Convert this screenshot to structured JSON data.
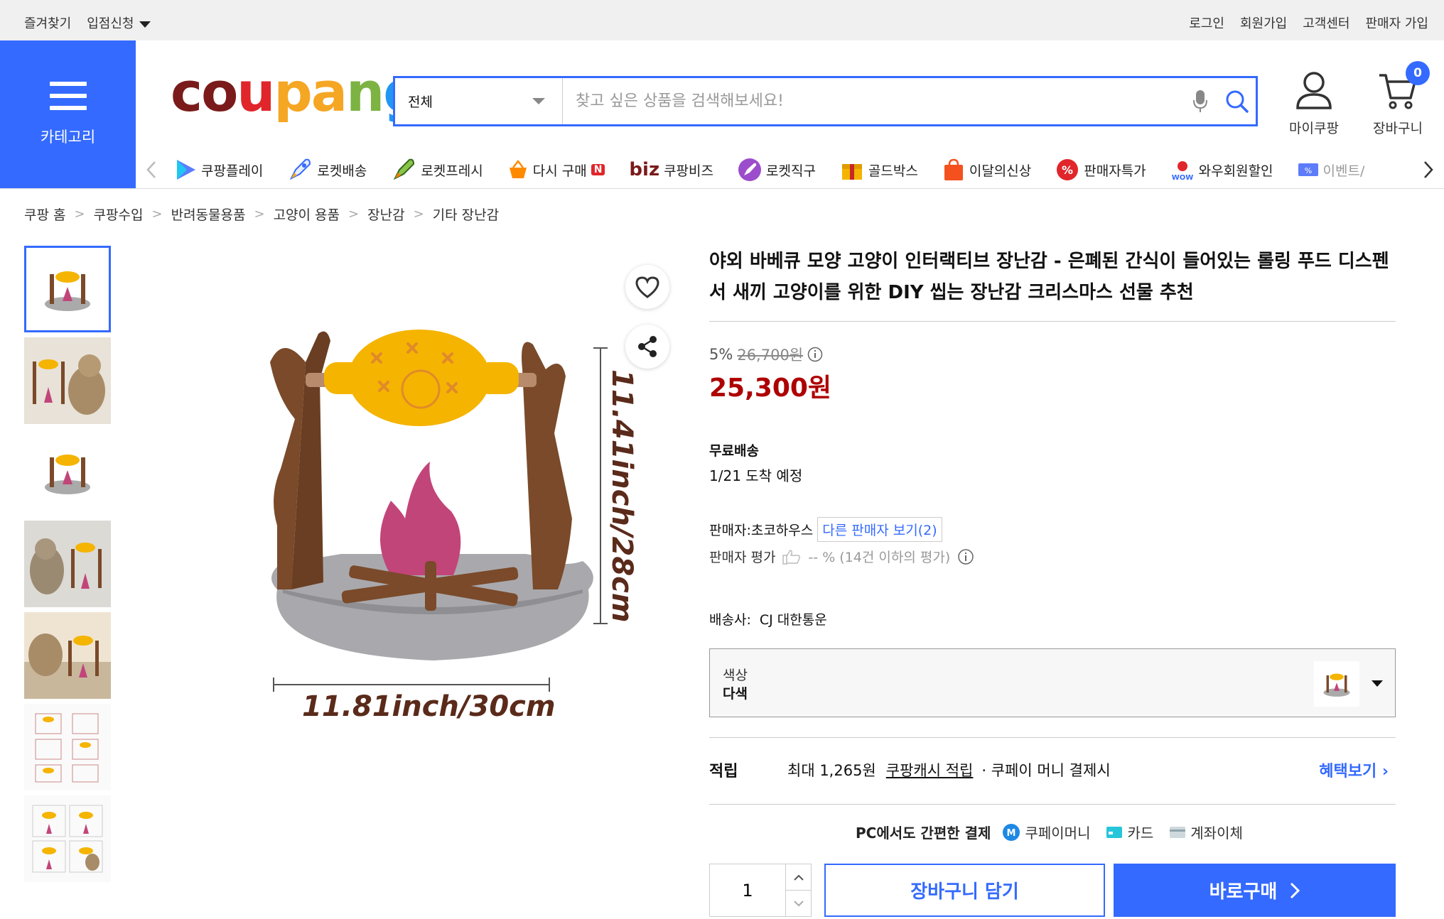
{
  "topbar": {
    "left": [
      "즐겨찾기",
      "입점신청"
    ],
    "right": [
      "로그인",
      "회원가입",
      "고객센터",
      "판매자 가입"
    ]
  },
  "category_label": "카테고리",
  "logo": [
    "c",
    "o",
    "u",
    "p",
    "a",
    "n",
    "g"
  ],
  "search": {
    "category": "전체",
    "placeholder": "찾고 싶은 상품을 검색해보세요!"
  },
  "header_icons": {
    "mycoupang": "마이쿠팡",
    "cart": "장바구니",
    "cart_count": "0"
  },
  "nav_items": [
    {
      "label": "쿠팡플레이",
      "icon": "play-icon"
    },
    {
      "label": "로켓배송",
      "icon": "rocket-icon"
    },
    {
      "label": "로켓프레시",
      "icon": "rocket-fresh-icon"
    },
    {
      "label": "다시 구매",
      "icon": "basket-icon",
      "badge": "N"
    },
    {
      "label": "쿠팡비즈",
      "icon": "biz-icon",
      "prefix": "biz"
    },
    {
      "label": "로켓직구",
      "icon": "rocket-global-icon"
    },
    {
      "label": "골드박스",
      "icon": "gold-box-icon"
    },
    {
      "label": "이달의신상",
      "icon": "new-bag-icon"
    },
    {
      "label": "판매자특가",
      "icon": "percent-icon"
    },
    {
      "label": "와우회원할인",
      "icon": "wow-icon"
    },
    {
      "label": "이벤트/",
      "icon": "event-icon"
    }
  ],
  "breadcrumb": [
    "쿠팡 홈",
    "쿠팡수입",
    "반려동물용품",
    "고양이 용품",
    "장난감",
    "기타 장난감"
  ],
  "image": {
    "height_label": "11.41inch/28cm",
    "width_label": "11.81inch/30cm"
  },
  "product": {
    "title": "야외 바베큐 모양 고양이 인터랙티브 장난감 - 은폐된 간식이 들어있는 롤링 푸드 디스펜서 새끼 고양이를 위한 DIY 씹는 장난감 크리스마스 선물 추천",
    "discount": "5%",
    "original_price": "26,700원",
    "price": "25,300원",
    "shipping": "무료배송",
    "arrival": "1/21 도착 예정",
    "seller_label": "판매자:",
    "seller": "초코하우스",
    "other_sellers": "다른 판매자 보기(2)",
    "rating_label": "판매자 평가",
    "rating_value": "-- % (14건 이하의 평가)",
    "courier_label": "배송사:",
    "courier": "CJ 대한통운",
    "option_label": "색상",
    "option_value": "다색"
  },
  "reward": {
    "label": "적립",
    "max": "최대 1,265원",
    "cash": "쿠팡캐시 적립",
    "pay": "· 쿠페이 머니 결제시",
    "more": "혜택보기"
  },
  "payment": {
    "title": "PC에서도 간편한 결제",
    "money": "쿠페이머니",
    "card": "카드",
    "bank": "계좌이체"
  },
  "purchase": {
    "quantity": "1",
    "cart_button": "장바구니 담기",
    "buy_button": "바로구매"
  },
  "colors": {
    "accent": "#346aff",
    "price": "#ae0000"
  }
}
